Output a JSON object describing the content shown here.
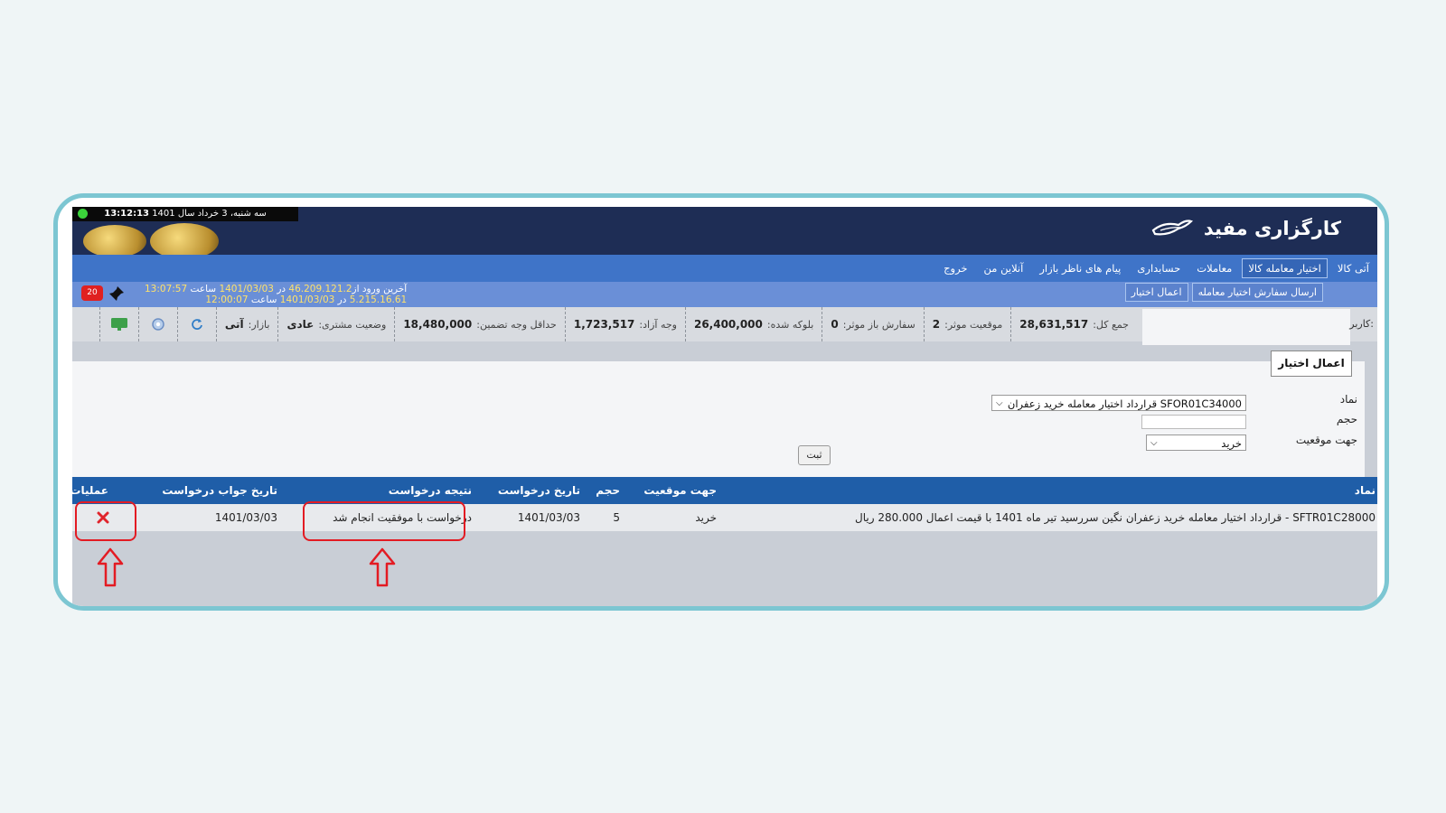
{
  "header": {
    "clock_time": "13:12:13",
    "clock_date": "سه شنبه، 3 خرداد سال 1401",
    "brand_name": "کارگزاری مفید"
  },
  "nav": {
    "items": [
      {
        "label": "آتی کالا"
      },
      {
        "label": "اختیار معامله کالا",
        "active": true
      },
      {
        "label": "معاملات"
      },
      {
        "label": "حسابداری"
      },
      {
        "label": "پیام های ناظر بازار"
      },
      {
        "label": "آنلاین من"
      },
      {
        "label": "خروج"
      }
    ],
    "sub_items": [
      {
        "label": "ارسال سفارش اختیار معامله"
      },
      {
        "label": "اعمال اختیار"
      }
    ]
  },
  "logins": {
    "line1_prefix": "آخرین ورود از",
    "line1_ip": "46.209.121.2",
    "line1_in": "در",
    "line1_date": "1401/03/03",
    "line1_at": "ساعت",
    "line1_time": "13:07:57",
    "line2_ip": "5.215.16.61",
    "line2_in": "در",
    "line2_date": "1401/03/03",
    "line2_at": "ساعت",
    "line2_time": "12:00:07"
  },
  "notifications": {
    "count": "20"
  },
  "status": {
    "user_label": "کاربر:",
    "total_label": "جمع کل:",
    "total_value": "28,631,517",
    "open_positions_label": "موقعیت موثر:",
    "open_positions_value": "2",
    "open_orders_label": "سفارش باز موثر:",
    "open_orders_value": "0",
    "blocked_label": "بلوکه شده:",
    "blocked_value": "26,400,000",
    "free_label": "وجه آزاد:",
    "free_value": "1,723,517",
    "min_margin_label": "حداقل وجه تضمین:",
    "min_margin_value": "18,480,000",
    "client_status_label": "وضعیت مشتری:",
    "client_status_value": "عادی",
    "market_label": "بازار:",
    "market_value": "آتی"
  },
  "form": {
    "tab_label": "اعمال اختیار",
    "symbol_label": "نماد",
    "symbol_value": "SFOR01C34000 قرارداد اختیار معامله خرید زعفران",
    "volume_label": "حجم",
    "volume_value": "",
    "side_label": "جهت موقعیت",
    "side_value": "خرید",
    "submit_label": "ثبت"
  },
  "table": {
    "headers": {
      "symbol": "نماد",
      "side": "جهت موقعیت",
      "volume": "حجم",
      "request_date": "تاریخ درخواست",
      "result": "نتیجه درخواست",
      "response_date": "تاریخ جواب درخواست",
      "actions": "عملیات"
    },
    "rows": [
      {
        "symbol": "SFTR01C28000 - قرارداد اختیار معامله خرید زعفران نگین سررسید تیر ماه 1401 با قیمت اعمال 280.000 ریال",
        "side": "خرید",
        "volume": "5",
        "request_date": "1401/03/03",
        "result": "درخواست با موفقیت انجام شد",
        "response_date": "1401/03/03"
      }
    ]
  },
  "colors": {
    "header_bg": "#1e2d55",
    "nav_bg": "#3f74c8",
    "table_header_bg": "#1f5ea8",
    "highlight": "#e31b23",
    "frame_border": "#7cc6d2"
  }
}
